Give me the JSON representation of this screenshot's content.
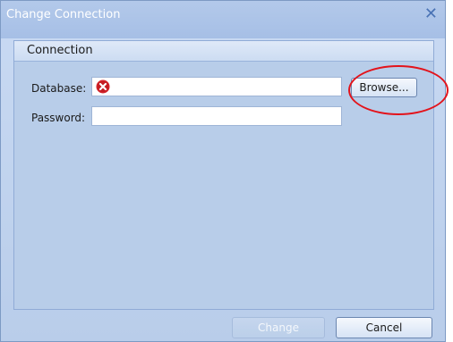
{
  "window": {
    "title": "Change Connection"
  },
  "group": {
    "header": "Connection"
  },
  "fields": {
    "database": {
      "label": "Database:",
      "value": "",
      "status_icon": "error-x-icon"
    },
    "password": {
      "label": "Password:",
      "value": ""
    }
  },
  "buttons": {
    "browse": "Browse...",
    "change": "Change",
    "cancel": "Cancel",
    "close_glyph": "✕"
  },
  "colors": {
    "error": "#d2232a",
    "annotation": "#e3131b",
    "accent": "#4a73b5"
  }
}
